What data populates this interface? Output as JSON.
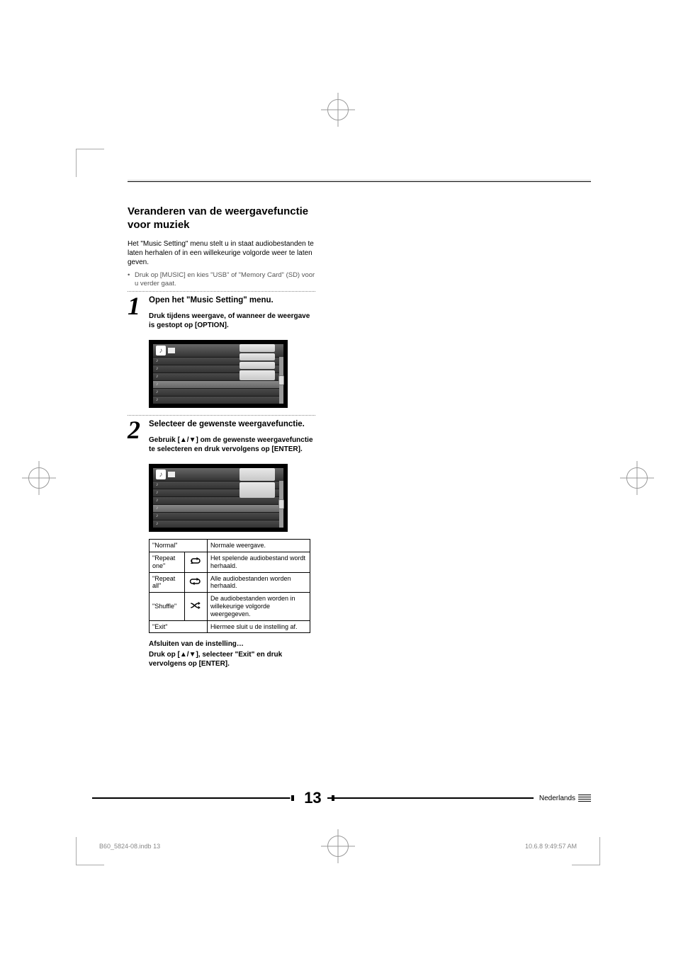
{
  "section": {
    "title": "Veranderen van de weergavefunctie voor muziek",
    "intro": "Het \"Music Setting\" menu stelt u in staat audiobestanden te laten herhalen of in een willekeurige volgorde weer te laten geven.",
    "bullet": "Druk op [MUSIC] en kies \"USB\" of \"Memory Card\" (SD) voor u verder gaat."
  },
  "steps": [
    {
      "num": "1",
      "title": "Open het \"Music Setting\" menu.",
      "sub": "Druk tijdens weergave, of wanneer de weergave is gestopt op [OPTION]."
    },
    {
      "num": "2",
      "title": "Selecteer de gewenste weergavefunctie.",
      "sub": "Gebruik [▲/▼] om de gewenste weergavefunctie te selecteren en druk vervolgens op [ENTER]."
    }
  ],
  "options_table": {
    "rows": [
      {
        "label": "\"Normal\"",
        "icon": "",
        "desc": "Normale weergave."
      },
      {
        "label": "\"Repeat one\"",
        "icon": "repeat-one",
        "desc": "Het spelende audiobestand wordt herhaald."
      },
      {
        "label": "\"Repeat all\"",
        "icon": "repeat-all",
        "desc": "Alle audiobestanden worden herhaald."
      },
      {
        "label": "\"Shuffle\"",
        "icon": "shuffle",
        "desc": "De audiobestanden worden in willekeurige volgorde weergegeven."
      },
      {
        "label": "\"Exit\"",
        "icon": "",
        "desc": "Hiermee sluit u de instelling af."
      }
    ]
  },
  "closing": {
    "title": "Afsluiten van de instelling…",
    "body": "Druk op [▲/▼], selecteer \"Exit\" en druk vervolgens op [ENTER]."
  },
  "page": {
    "number": "13",
    "language": "Nederlands"
  },
  "footer": {
    "left": "B60_5824-08.indb   13",
    "right": "10.6.8   9:49:57 AM"
  }
}
